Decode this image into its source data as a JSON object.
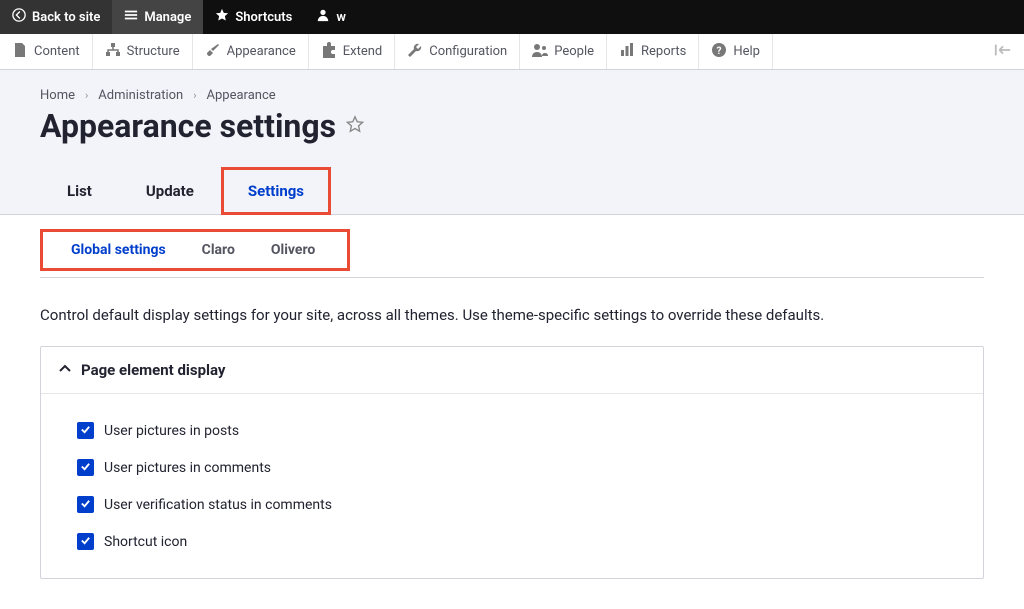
{
  "topbar": {
    "back_label": "Back to site",
    "manage_label": "Manage",
    "shortcuts_label": "Shortcuts",
    "user_label": "w"
  },
  "adminbar": {
    "items": [
      {
        "label": "Content"
      },
      {
        "label": "Structure"
      },
      {
        "label": "Appearance"
      },
      {
        "label": "Extend"
      },
      {
        "label": "Configuration"
      },
      {
        "label": "People"
      },
      {
        "label": "Reports"
      },
      {
        "label": "Help"
      }
    ]
  },
  "breadcrumb": {
    "items": [
      {
        "label": "Home"
      },
      {
        "label": "Administration"
      },
      {
        "label": "Appearance"
      }
    ]
  },
  "page_title": "Appearance settings",
  "primary_tabs": {
    "items": [
      {
        "label": "List",
        "active": false
      },
      {
        "label": "Update",
        "active": false
      },
      {
        "label": "Settings",
        "active": true
      }
    ]
  },
  "secondary_tabs": {
    "items": [
      {
        "label": "Global settings",
        "active": true
      },
      {
        "label": "Claro",
        "active": false
      },
      {
        "label": "Olivero",
        "active": false
      }
    ]
  },
  "intro": "Control default display settings for your site, across all themes. Use theme-specific settings to override these defaults.",
  "details": {
    "summary": "Page element display",
    "checks": [
      {
        "label": "User pictures in posts",
        "checked": true
      },
      {
        "label": "User pictures in comments",
        "checked": true
      },
      {
        "label": "User verification status in comments",
        "checked": true
      },
      {
        "label": "Shortcut icon",
        "checked": true
      }
    ]
  }
}
